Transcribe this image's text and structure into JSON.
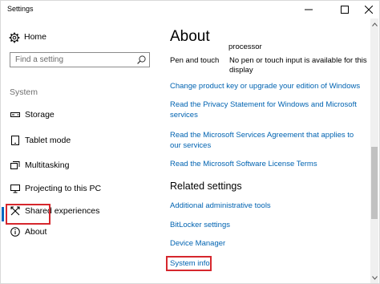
{
  "window": {
    "title": "Settings"
  },
  "sidebar": {
    "home_label": "Home",
    "search_placeholder": "Find a setting",
    "section_label": "System",
    "items": [
      {
        "label": "Storage",
        "icon": "storage-icon"
      },
      {
        "label": "Tablet mode",
        "icon": "tablet-mode-icon"
      },
      {
        "label": "Multitasking",
        "icon": "multitasking-icon"
      },
      {
        "label": "Projecting to this PC",
        "icon": "projecting-icon"
      },
      {
        "label": "Shared experiences",
        "icon": "shared-experiences-icon"
      },
      {
        "label": "About",
        "icon": "info-icon",
        "selected": true
      }
    ]
  },
  "main": {
    "title": "About",
    "partial_text": "processor",
    "specs": [
      {
        "key": "Pen and touch",
        "value": "No pen or touch input is available for this display"
      }
    ],
    "links": [
      "Change product key or upgrade your edition of Windows",
      "Read the Privacy Statement for Windows and Microsoft services",
      "Read the Microsoft Services Agreement that applies to our services",
      "Read the Microsoft Software License Terms"
    ],
    "related_heading": "Related settings",
    "related_links": [
      "Additional administrative tools",
      "BitLocker settings",
      "Device Manager",
      "System info"
    ]
  },
  "colors": {
    "accent": "#0067c0",
    "link": "#0063b1",
    "highlight_box": "#d6272d",
    "section_label": "#6e6e6e"
  }
}
